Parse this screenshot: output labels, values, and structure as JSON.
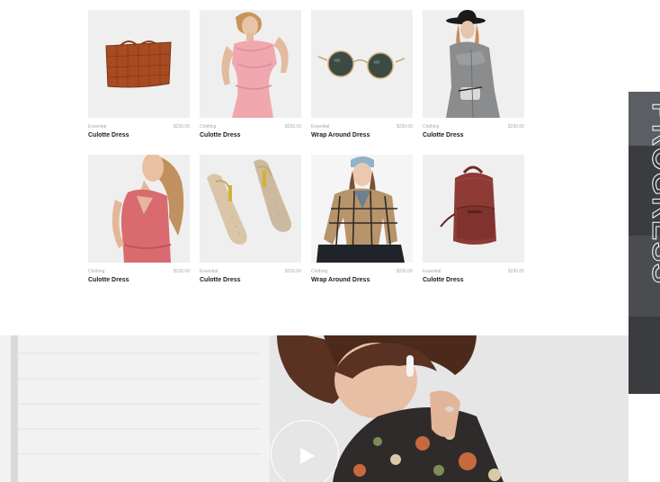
{
  "products": [
    {
      "category": "Essential",
      "price": "$230.00",
      "name": "Culotte Dress",
      "image": "brown-leather-handbag"
    },
    {
      "category": "Clothing",
      "price": "$230.00",
      "name": "Culotte Dress",
      "image": "model-pink-ruffle-dress"
    },
    {
      "category": "Essential",
      "price": "$230.00",
      "name": "Wrap Around Dress",
      "image": "round-sunglasses"
    },
    {
      "category": "Clothing",
      "price": "$230.00",
      "name": "Culotte Dress",
      "image": "model-grey-coat-hat"
    },
    {
      "category": "Clothing",
      "price": "$230.00",
      "name": "Culotte Dress",
      "image": "model-pink-sleeveless-dress"
    },
    {
      "category": "Essential",
      "price": "$230.00",
      "name": "Culotte Dress",
      "image": "strappy-heeled-sandals"
    },
    {
      "category": "Clothing",
      "price": "$230.00",
      "name": "Wrap Around Dress",
      "image": "model-plaid-shirt-beanie"
    },
    {
      "category": "Essential",
      "price": "$230.00",
      "name": "Culotte Dress",
      "image": "burgundy-leather-backpack"
    }
  ],
  "side_banner": {
    "text": "PROGRESS"
  },
  "hero": {
    "image": "woman-with-earbuds-floral-shirt",
    "play_icon": "play-icon"
  }
}
